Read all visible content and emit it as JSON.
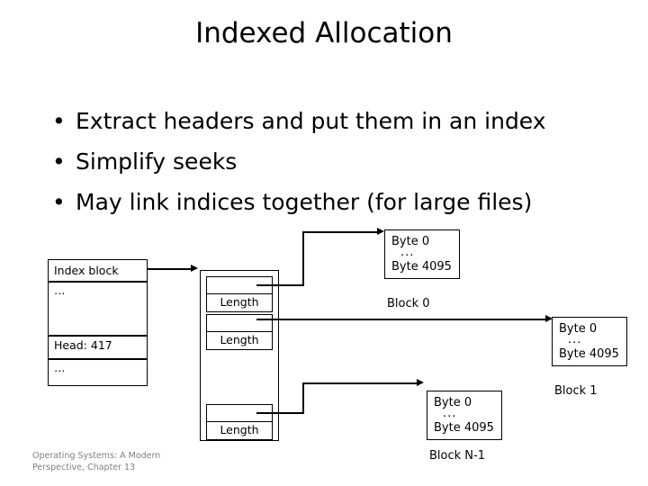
{
  "slide": {
    "title": "Indexed Allocation",
    "bullet_marker": "•",
    "bullets": [
      "Extract headers and put them in an index",
      "Simplify seeks",
      "May link indices together (for large files)"
    ],
    "footer_line1": "Operating Systems: A Modern",
    "footer_line2": "Perspective, Chapter 13"
  },
  "diagram": {
    "index_block": {
      "rows": [
        "Index block",
        "…",
        "Head: 417",
        "…"
      ]
    },
    "pointer_table": {
      "entries": [
        {
          "pointer": "",
          "length_label": "Length"
        },
        {
          "pointer": "",
          "length_label": "Length"
        },
        {
          "pointer": "",
          "length_label": "Length"
        }
      ]
    },
    "data_blocks": [
      {
        "first_byte": "Byte 0",
        "ellipsis": "...",
        "last_byte": "Byte 4095",
        "caption": "Block 0"
      },
      {
        "first_byte": "Byte 0",
        "ellipsis": "...",
        "last_byte": "Byte 4095",
        "caption": "Block 1"
      },
      {
        "first_byte": "Byte 0",
        "ellipsis": "...",
        "last_byte": "Byte 4095",
        "caption": "Block N-1"
      }
    ]
  },
  "colors": {
    "background": "#ffffff",
    "ink": "#000000",
    "footer_text": "#7f7f7f"
  }
}
